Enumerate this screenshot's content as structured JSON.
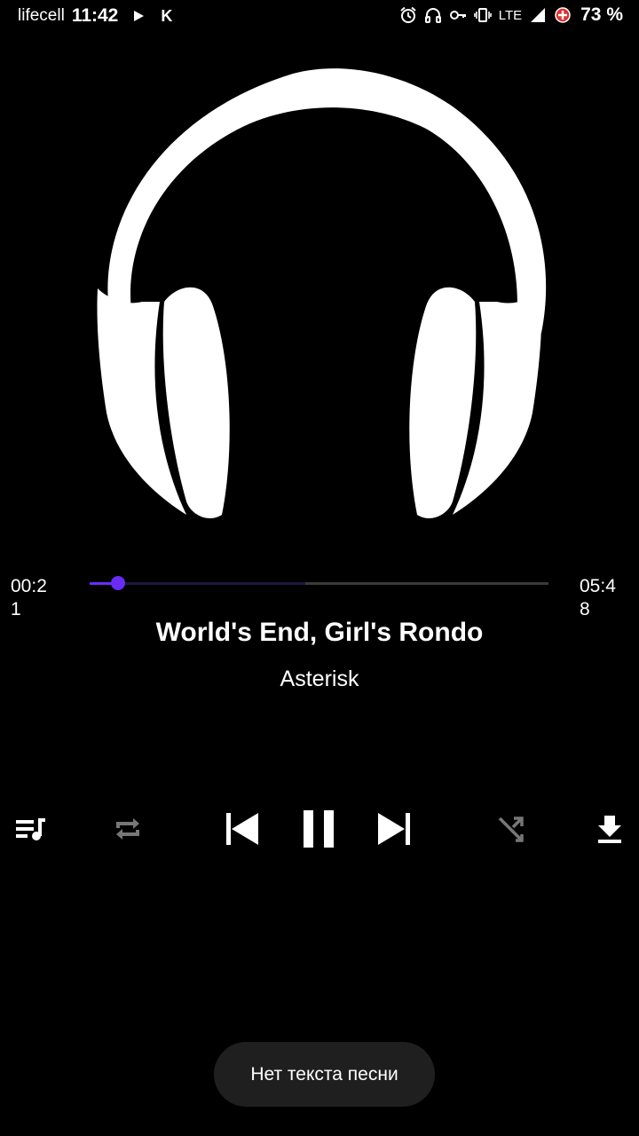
{
  "status_bar": {
    "carrier": "lifecell",
    "time": "11:42",
    "app_letter": "K",
    "network": "LTE",
    "battery_percent": "73 %",
    "icons": [
      "play-icon",
      "alarm-icon",
      "headphones-icon",
      "key-icon",
      "vibrate-icon",
      "signal-icon",
      "battery-saver-icon"
    ]
  },
  "player": {
    "album_art_icon": "headphones-icon",
    "elapsed": "00:21",
    "total": "05:48",
    "progress": 0.062,
    "buffered": 0.47,
    "title": "World's End, Girl's Rondo",
    "artist": "Asterisk",
    "accent_color": "#6a2cf5"
  },
  "controls": {
    "queue": "queue-music-icon",
    "repeat": "repeat-icon",
    "previous": "skip-previous-icon",
    "play_pause": "pause-icon",
    "next": "skip-next-icon",
    "shuffle": "shuffle-icon",
    "download": "download-icon"
  },
  "toast": {
    "text": "Нет текста песни"
  }
}
